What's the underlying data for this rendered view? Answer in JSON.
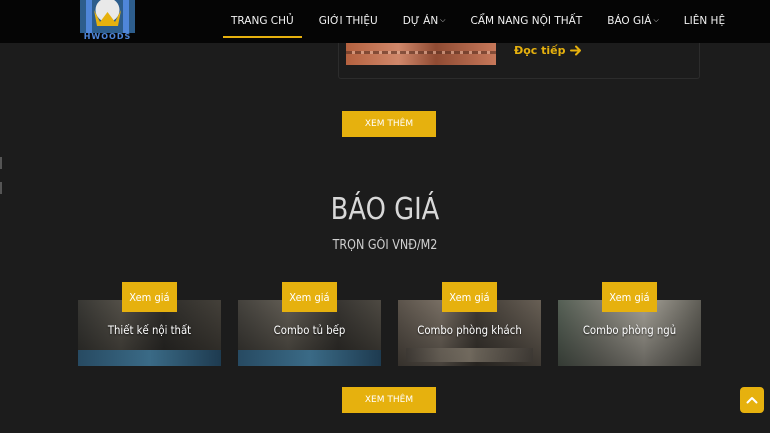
{
  "brand": {
    "logo_text": "HWOODS",
    "accent": "#e6b10e"
  },
  "nav": {
    "items": [
      {
        "label": "TRANG CHỦ",
        "active": true
      },
      {
        "label": "GIỚI THIỆU"
      },
      {
        "label": "DỰ ÁN",
        "has_dropdown": true
      },
      {
        "label": "CẨM NANG NỘI THẤT"
      },
      {
        "label": "BÁO GIÁ",
        "has_dropdown": true
      },
      {
        "label": "LIÊN HỆ"
      }
    ]
  },
  "blog": {
    "read_more": "Đọc tiếp"
  },
  "top_section": {
    "more_button": "XEM THÊM"
  },
  "pricing": {
    "title": "BÁO GIÁ",
    "subtitle": "TRỌN GÓI VNĐ/M2",
    "cards": [
      {
        "badge": "Xem giá",
        "label": "Thiết kế nội thất"
      },
      {
        "badge": "Xem giá",
        "label": "Combo tủ bếp"
      },
      {
        "badge": "Xem giá",
        "label": "Combo phòng khách"
      },
      {
        "badge": "Xem giá",
        "label": "Combo phòng ngủ"
      }
    ],
    "more_button": "XEM THÊM"
  },
  "icons": {
    "logo": "hwoods-logo-icon",
    "arrow": "arrow-right-icon",
    "caret": "chevron-down-icon",
    "back_to_top": "chevron-up-icon"
  }
}
